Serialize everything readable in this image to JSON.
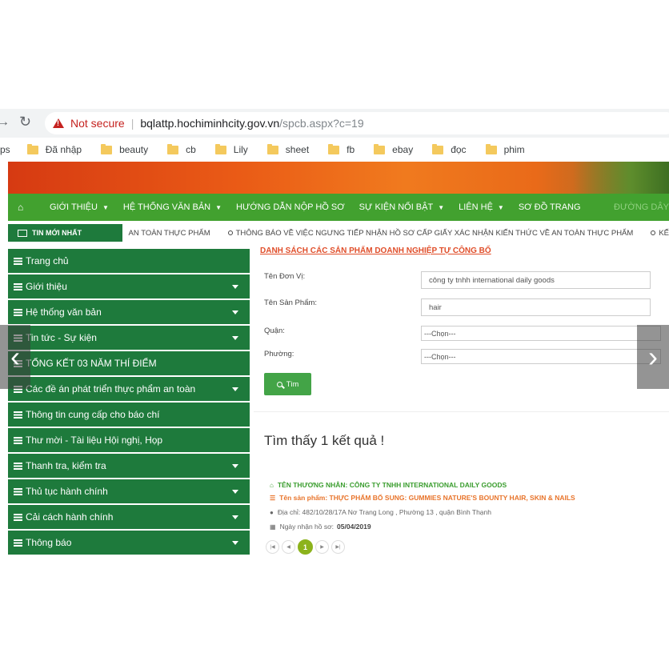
{
  "browser": {
    "warning": "Not secure",
    "url_host": "bqlattp.hochiminhcity.gov.vn",
    "url_path": "/spcb.aspx?c=19",
    "apps_label": "ps",
    "bookmarks": [
      "Đã nhập",
      "beauty",
      "cb",
      "Lily",
      "sheet",
      "fb",
      "ebay",
      "đọc",
      "phim"
    ]
  },
  "menu": {
    "items": [
      "GIỚI THIỆU",
      "HỆ THỐNG VĂN BẢN",
      "HƯỚNG DẪN NỘP HỒ SƠ",
      "SỰ KIỆN NỔI BẬT",
      "LIÊN HỆ",
      "SƠ ĐỒ TRANG"
    ],
    "right_text": "ĐƯỜNG DÂY"
  },
  "ticker": {
    "label": "TIN MỚI NHẤT",
    "text1": "AN TOÀN THỰC PHẨM",
    "text2": "THÔNG BÁO VỀ VIỆC NGƯNG TIẾP NHẬN HỒ SƠ CẤP GIẤY XÁC NHẬN KIẾN THỨC VỀ AN TOÀN THỰC PHẨM",
    "text3": "KẾ"
  },
  "sidebar": {
    "items": [
      {
        "label": "Trang chủ"
      },
      {
        "label": "Giới thiệu"
      },
      {
        "label": "Hệ thống văn bản"
      },
      {
        "label": "Tin tức - Sự kiện"
      },
      {
        "label": "TỔNG KẾT 03 NĂM THÍ ĐIỂM"
      },
      {
        "label": "Các đề án phát triển thực phẩm an toàn"
      },
      {
        "label": "Thông tin cung cấp cho báo chí"
      },
      {
        "label": "Thư mời - Tài liệu Hội nghị, Họp"
      },
      {
        "label": "Thanh tra, kiểm tra"
      },
      {
        "label": "Thủ tục hành chính"
      },
      {
        "label": "Cải cách hành chính"
      },
      {
        "label": "Thông báo"
      }
    ]
  },
  "form": {
    "title": "DANH SÁCH CÁC SẢN PHẨM DOANH NGHIỆP TỰ CÔNG BỐ",
    "unit_label": "Tên Đơn Vị:",
    "unit_value": "công ty tnhh international daily goods",
    "product_label": "Tên Sản Phẩm:",
    "product_value": "hair",
    "district_label": "Quận:",
    "district_value": "---Chọn---",
    "ward_label": "Phường:",
    "ward_value": "---Chọn---",
    "search_label": "Tìm"
  },
  "results": {
    "count_text": "Tìm thấy 1 kết quả !",
    "merchant": "TÊN THƯƠNG NHÂN: CÔNG TY TNHH INTERNATIONAL DAILY GOODS",
    "product": "Tên sản phẩm: THỰC PHẨM BỔ SUNG: GUMMIES NATURE'S BOUNTY HAIR, SKIN & NAILS",
    "address": "Địa chỉ: 482/10/28/17A Nơ Trang Long , Phường 13 , quận Bình Thạnh",
    "date_label": "Ngày nhận hồ sơ:",
    "date_value": "05/04/2019",
    "current_page": "1"
  }
}
